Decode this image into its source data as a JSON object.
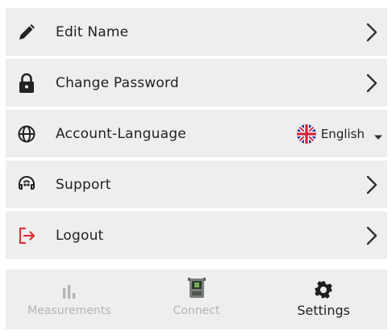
{
  "menu": {
    "items": [
      {
        "label": "Edit Name",
        "icon": "pencil-icon"
      },
      {
        "label": "Change Password",
        "icon": "lock-icon"
      },
      {
        "label": "Account-Language",
        "icon": "globe-icon",
        "selected_language": "English",
        "flag": "uk-flag-icon"
      },
      {
        "label": "Support",
        "icon": "headset-icon"
      },
      {
        "label": "Logout",
        "icon": "logout-icon"
      }
    ]
  },
  "tabbar": {
    "tabs": [
      {
        "label": "Measurements",
        "icon": "bar-chart-icon",
        "active": false
      },
      {
        "label": "Connect",
        "icon": "device-icon",
        "active": false
      },
      {
        "label": "Settings",
        "icon": "gear-icon",
        "active": true
      }
    ]
  },
  "colors": {
    "row_background": "#eeeeee",
    "logout_accent": "#d9343a",
    "inactive_tab_text": "#b4b4b4"
  }
}
